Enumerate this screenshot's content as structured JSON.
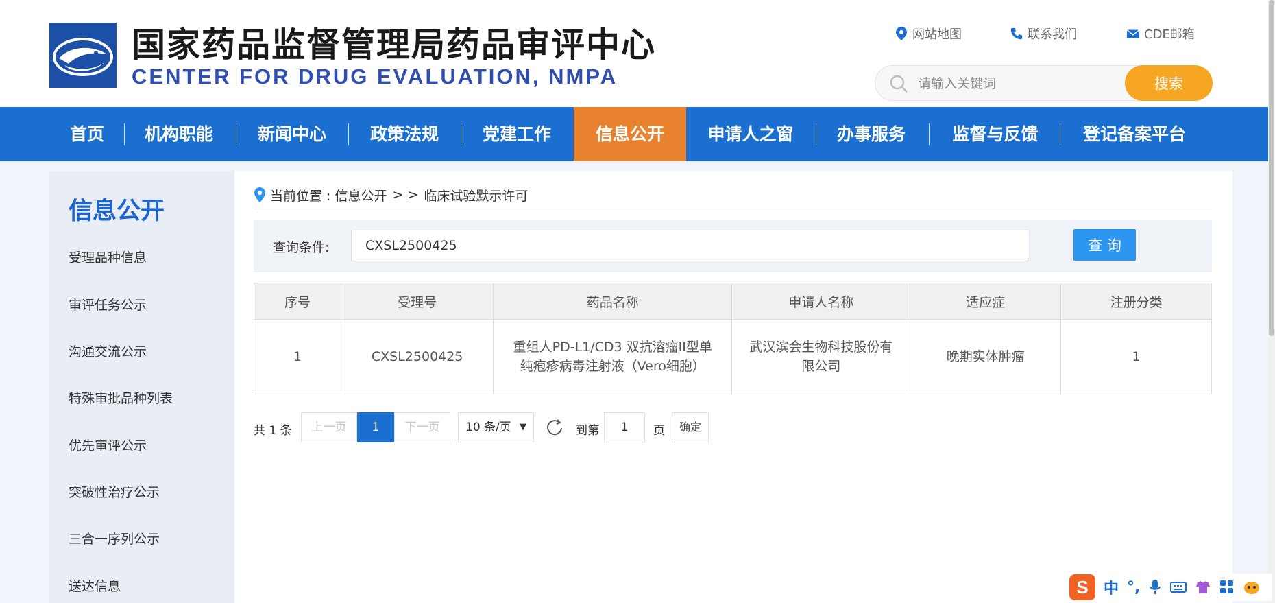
{
  "site": {
    "title_cn": "国家药品监督管理局药品审评中心",
    "title_en": "CENTER FOR DRUG EVALUATION, NMPA"
  },
  "top_links": [
    {
      "label": "网站地图",
      "icon": "map-pin-icon"
    },
    {
      "label": "联系我们",
      "icon": "phone-icon"
    },
    {
      "label": "CDE邮箱",
      "icon": "mail-icon"
    }
  ],
  "search": {
    "placeholder": "请输入关键词",
    "button": "搜索"
  },
  "nav": [
    {
      "label": "首页"
    },
    {
      "label": "机构职能"
    },
    {
      "label": "新闻中心"
    },
    {
      "label": "政策法规"
    },
    {
      "label": "党建工作"
    },
    {
      "label": "信息公开",
      "active": true
    },
    {
      "label": "申请人之窗"
    },
    {
      "label": "办事服务"
    },
    {
      "label": "监督与反馈"
    },
    {
      "label": "登记备案平台"
    }
  ],
  "sidebar": {
    "title": "信息公开",
    "items": [
      {
        "label": "受理品种信息"
      },
      {
        "label": "审评任务公示"
      },
      {
        "label": "沟通交流公示"
      },
      {
        "label": "特殊审批品种列表"
      },
      {
        "label": "优先审评公示"
      },
      {
        "label": "突破性治疗公示"
      },
      {
        "label": "三合一序列公示"
      },
      {
        "label": "送达信息"
      }
    ]
  },
  "breadcrumb": {
    "prefix": "当前位置 : 信息公开",
    "separator": "> >",
    "current": "临床试验默示许可"
  },
  "query": {
    "label": "查询条件:",
    "value": "CXSL2500425",
    "button": "查 询"
  },
  "table": {
    "headers": [
      "序号",
      "受理号",
      "药品名称",
      "申请人名称",
      "适应症",
      "注册分类"
    ],
    "rows": [
      [
        "1",
        "CXSL2500425",
        "重组人PD-L1/CD3 双抗溶瘤II型单纯疱疹病毒注射液（Vero细胞）",
        "武汉滨会生物科技股份有限公司",
        "晚期实体肿瘤",
        "1"
      ]
    ]
  },
  "pager": {
    "total": "共 1 条",
    "prev": "上一页",
    "current": "1",
    "next": "下一页",
    "page_size": "10 条/页",
    "goto_label": "到第",
    "goto_value": "1",
    "page_unit": "页",
    "confirm": "确定"
  },
  "ime": {
    "logo": "S",
    "lang": "中",
    "punct": "°,",
    "icons": [
      "mic-icon",
      "keyboard-icon",
      "skin-icon",
      "apps-icon",
      "mascot-icon"
    ]
  },
  "colors": {
    "nav_bg": "#1a6fd0",
    "nav_active": "#e8822e",
    "search_button": "#f6a623",
    "query_button": "#2b95f0",
    "sidebar_title": "#1c64d2"
  }
}
